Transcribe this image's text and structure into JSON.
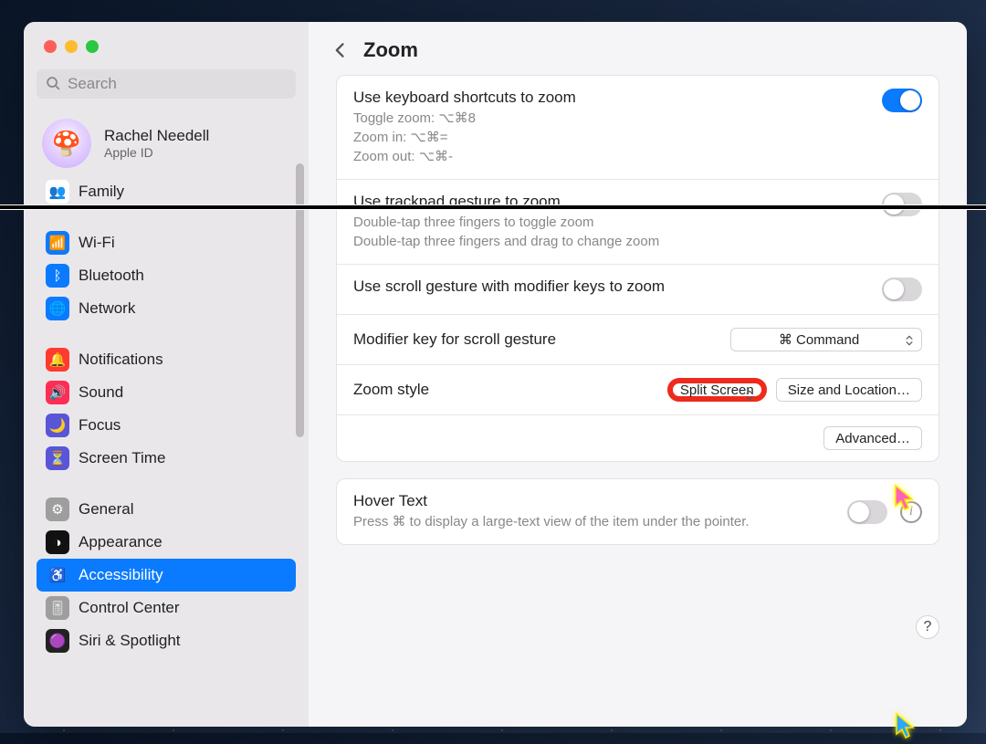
{
  "header": {
    "title": "Zoom"
  },
  "search": {
    "placeholder": "Search"
  },
  "account": {
    "name": "Rachel Needell",
    "sub": "Apple ID",
    "avatar_emoji": "🍄"
  },
  "sidebar": {
    "items": [
      {
        "label": "Family",
        "icon_bg": "#ffffff",
        "icon_color": "#0a7aff",
        "glyph": "👥"
      },
      {
        "label": "Wi-Fi",
        "icon_bg": "#0a7aff",
        "glyph": "📶"
      },
      {
        "label": "Bluetooth",
        "icon_bg": "#0a7aff",
        "glyph": "ᛒ"
      },
      {
        "label": "Network",
        "icon_bg": "#0a7aff",
        "glyph": "🌐"
      },
      {
        "label": "Notifications",
        "icon_bg": "#ff3b30",
        "glyph": "🔔"
      },
      {
        "label": "Sound",
        "icon_bg": "#ff2d55",
        "glyph": "🔊"
      },
      {
        "label": "Focus",
        "icon_bg": "#5856d6",
        "glyph": "🌙"
      },
      {
        "label": "Screen Time",
        "icon_bg": "#5856d6",
        "glyph": "⏳"
      },
      {
        "label": "General",
        "icon_bg": "#9e9e9e",
        "glyph": "⚙"
      },
      {
        "label": "Appearance",
        "icon_bg": "#111111",
        "glyph": "◑"
      },
      {
        "label": "Accessibility",
        "icon_bg": "#0a7aff",
        "glyph": "♿",
        "active": true
      },
      {
        "label": "Control Center",
        "icon_bg": "#9e9e9e",
        "glyph": "🎚"
      },
      {
        "label": "Siri & Spotlight",
        "icon_bg": "#222",
        "glyph": "🟣"
      }
    ]
  },
  "rows": {
    "keyboard": {
      "title": "Use keyboard shortcuts to zoom",
      "l1": "Toggle zoom: ⌥⌘8",
      "l2": "Zoom in: ⌥⌘=",
      "l3": "Zoom out: ⌥⌘-",
      "on": true
    },
    "trackpad": {
      "title": "Use trackpad gesture to zoom",
      "l1": "Double-tap three fingers to toggle zoom",
      "l2": "Double-tap three fingers and drag to change zoom",
      "on": false
    },
    "scroll": {
      "title": "Use scroll gesture with modifier keys to zoom",
      "on": false
    },
    "modifier": {
      "title": "Modifier key for scroll gesture",
      "value": "⌘ Command"
    },
    "zoomstyle": {
      "title": "Zoom style",
      "value": "Split Screen",
      "button": "Size and Location…"
    },
    "advanced": {
      "label": "Advanced…"
    },
    "hover": {
      "title": "Hover Text",
      "desc": "Press ⌘ to display a large-text view of the item under the pointer.",
      "on": false
    }
  },
  "help": {
    "label": "?"
  }
}
